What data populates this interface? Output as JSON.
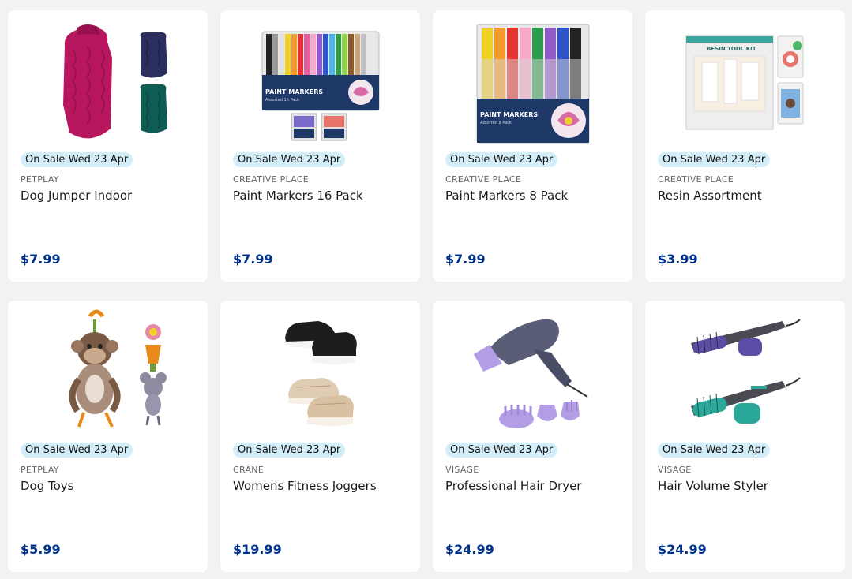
{
  "products": [
    {
      "badge": "On Sale Wed 23 Apr",
      "brand": "PETPLAY",
      "name": "Dog Jumper Indoor",
      "price": "$7.99",
      "image": "dog-jumper-image"
    },
    {
      "badge": "On Sale Wed 23 Apr",
      "brand": "CREATIVE PLACE",
      "name": "Paint Markers 16 Pack",
      "price": "$7.99",
      "image": "paint-markers-16-image"
    },
    {
      "badge": "On Sale Wed 23 Apr",
      "brand": "CREATIVE PLACE",
      "name": "Paint Markers 8 Pack",
      "price": "$7.99",
      "image": "paint-markers-8-image"
    },
    {
      "badge": "On Sale Wed 23 Apr",
      "brand": "CREATIVE PLACE",
      "name": "Resin Assortment",
      "price": "$3.99",
      "image": "resin-kit-image"
    },
    {
      "badge": "On Sale Wed 23 Apr",
      "brand": "PETPLAY",
      "name": "Dog Toys",
      "price": "$5.99",
      "image": "dog-toys-image"
    },
    {
      "badge": "On Sale Wed 23 Apr",
      "brand": "CRANE",
      "name": "Womens Fitness Joggers",
      "price": "$19.99",
      "image": "joggers-image"
    },
    {
      "badge": "On Sale Wed 23 Apr",
      "brand": "VISAGE",
      "name": "Professional Hair Dryer",
      "price": "$24.99",
      "image": "hair-dryer-image"
    },
    {
      "badge": "On Sale Wed 23 Apr",
      "brand": "VISAGE",
      "name": "Hair Volume Styler",
      "price": "$24.99",
      "image": "hair-styler-image"
    }
  ],
  "product_images": {
    "paint_markers_16": {
      "box_label": "PAINT MARKERS",
      "box_sublabel": "Assorted 16 Pack"
    },
    "paint_markers_8": {
      "box_label": "PAINT MARKERS",
      "box_sublabel": "Assorted 8 Pack"
    },
    "resin_kit": {
      "box_label": "RESIN TOOL KIT"
    }
  },
  "colors": {
    "page_bg": "#f2f2f2",
    "card_bg": "#ffffff",
    "badge_bg": "#d4eef9",
    "price": "#00338d"
  }
}
